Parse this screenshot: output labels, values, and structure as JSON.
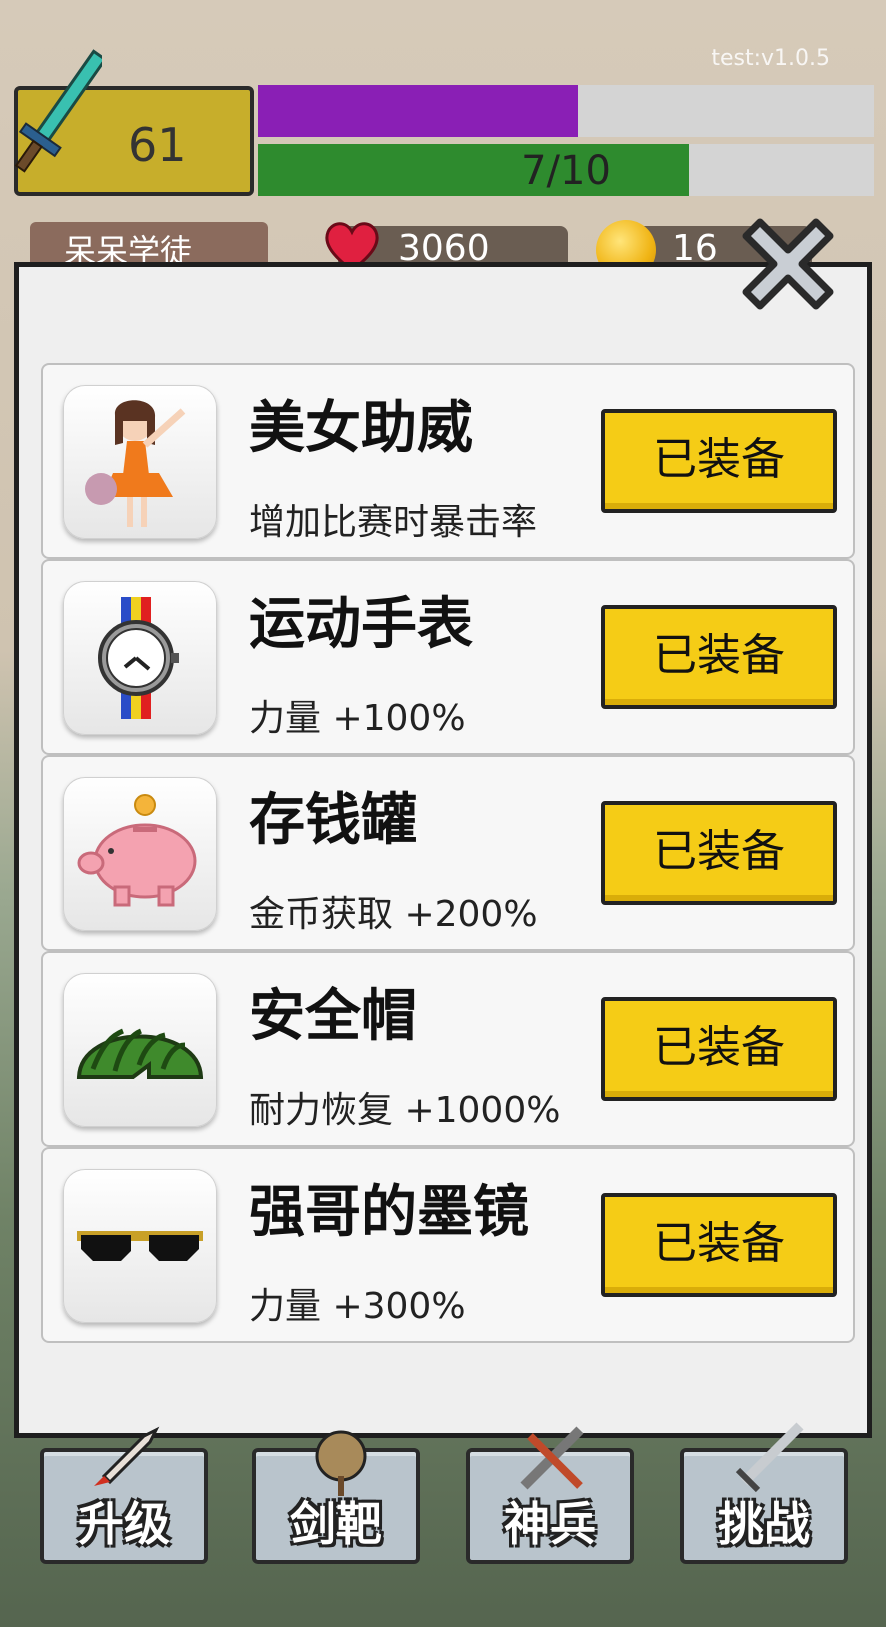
{
  "hud": {
    "version": "test:v1.0.5",
    "level": "61",
    "xp_progress": 0.52,
    "stamina_progress": 0.7,
    "stamina_label": "7/10",
    "title": "呆呆学徒",
    "hearts": "3060",
    "coins": "16"
  },
  "items": [
    {
      "name": "美女助威",
      "desc": "增加比赛时暴击率",
      "button": "已装备",
      "icon": "cheerleader-icon"
    },
    {
      "name": "运动手表",
      "desc": "力量 +100%",
      "button": "已装备",
      "icon": "watch-icon"
    },
    {
      "name": "存钱罐",
      "desc": "金币获取 +200%",
      "button": "已装备",
      "icon": "piggy-bank-icon"
    },
    {
      "name": "安全帽",
      "desc": "耐力恢复 +1000%",
      "button": "已装备",
      "icon": "watermelon-helmet-icon"
    },
    {
      "name": "强哥的墨镜",
      "desc": "力量 +300%",
      "button": "已装备",
      "icon": "sunglasses-icon"
    }
  ],
  "nav": {
    "upgrade": "升级",
    "target": "剑靶",
    "weapon": "神兵",
    "challenge": "挑战"
  },
  "colors": {
    "xp_bar": "#8a1fb5",
    "stamina_bar": "#2e8b2e",
    "equip_button": "#f5cc16"
  }
}
